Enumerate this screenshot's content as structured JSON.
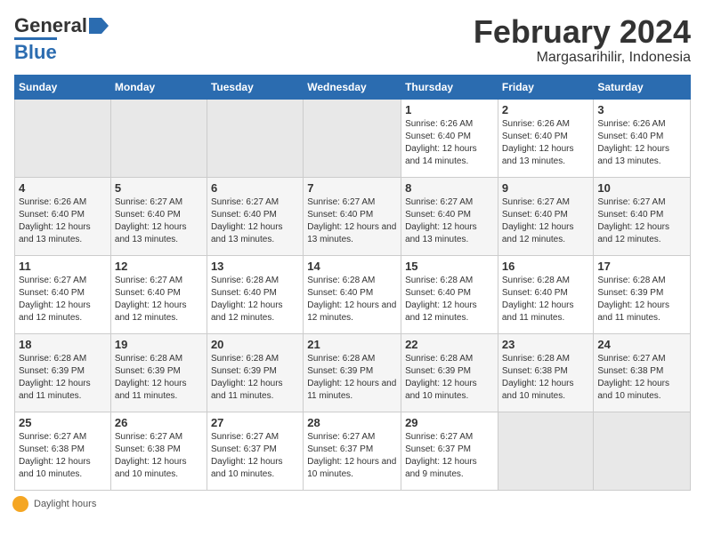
{
  "header": {
    "logo_general": "General",
    "logo_blue": "Blue",
    "month_title": "February 2024",
    "location": "Margasarihilir, Indonesia"
  },
  "days_of_week": [
    "Sunday",
    "Monday",
    "Tuesday",
    "Wednesday",
    "Thursday",
    "Friday",
    "Saturday"
  ],
  "weeks": [
    [
      {
        "num": "",
        "info": ""
      },
      {
        "num": "",
        "info": ""
      },
      {
        "num": "",
        "info": ""
      },
      {
        "num": "",
        "info": ""
      },
      {
        "num": "1",
        "info": "Sunrise: 6:26 AM\nSunset: 6:40 PM\nDaylight: 12 hours and 14 minutes."
      },
      {
        "num": "2",
        "info": "Sunrise: 6:26 AM\nSunset: 6:40 PM\nDaylight: 12 hours and 13 minutes."
      },
      {
        "num": "3",
        "info": "Sunrise: 6:26 AM\nSunset: 6:40 PM\nDaylight: 12 hours and 13 minutes."
      }
    ],
    [
      {
        "num": "4",
        "info": "Sunrise: 6:26 AM\nSunset: 6:40 PM\nDaylight: 12 hours and 13 minutes."
      },
      {
        "num": "5",
        "info": "Sunrise: 6:27 AM\nSunset: 6:40 PM\nDaylight: 12 hours and 13 minutes."
      },
      {
        "num": "6",
        "info": "Sunrise: 6:27 AM\nSunset: 6:40 PM\nDaylight: 12 hours and 13 minutes."
      },
      {
        "num": "7",
        "info": "Sunrise: 6:27 AM\nSunset: 6:40 PM\nDaylight: 12 hours and 13 minutes."
      },
      {
        "num": "8",
        "info": "Sunrise: 6:27 AM\nSunset: 6:40 PM\nDaylight: 12 hours and 13 minutes."
      },
      {
        "num": "9",
        "info": "Sunrise: 6:27 AM\nSunset: 6:40 PM\nDaylight: 12 hours and 12 minutes."
      },
      {
        "num": "10",
        "info": "Sunrise: 6:27 AM\nSunset: 6:40 PM\nDaylight: 12 hours and 12 minutes."
      }
    ],
    [
      {
        "num": "11",
        "info": "Sunrise: 6:27 AM\nSunset: 6:40 PM\nDaylight: 12 hours and 12 minutes."
      },
      {
        "num": "12",
        "info": "Sunrise: 6:27 AM\nSunset: 6:40 PM\nDaylight: 12 hours and 12 minutes."
      },
      {
        "num": "13",
        "info": "Sunrise: 6:28 AM\nSunset: 6:40 PM\nDaylight: 12 hours and 12 minutes."
      },
      {
        "num": "14",
        "info": "Sunrise: 6:28 AM\nSunset: 6:40 PM\nDaylight: 12 hours and 12 minutes."
      },
      {
        "num": "15",
        "info": "Sunrise: 6:28 AM\nSunset: 6:40 PM\nDaylight: 12 hours and 12 minutes."
      },
      {
        "num": "16",
        "info": "Sunrise: 6:28 AM\nSunset: 6:40 PM\nDaylight: 12 hours and 11 minutes."
      },
      {
        "num": "17",
        "info": "Sunrise: 6:28 AM\nSunset: 6:39 PM\nDaylight: 12 hours and 11 minutes."
      }
    ],
    [
      {
        "num": "18",
        "info": "Sunrise: 6:28 AM\nSunset: 6:39 PM\nDaylight: 12 hours and 11 minutes."
      },
      {
        "num": "19",
        "info": "Sunrise: 6:28 AM\nSunset: 6:39 PM\nDaylight: 12 hours and 11 minutes."
      },
      {
        "num": "20",
        "info": "Sunrise: 6:28 AM\nSunset: 6:39 PM\nDaylight: 12 hours and 11 minutes."
      },
      {
        "num": "21",
        "info": "Sunrise: 6:28 AM\nSunset: 6:39 PM\nDaylight: 12 hours and 11 minutes."
      },
      {
        "num": "22",
        "info": "Sunrise: 6:28 AM\nSunset: 6:39 PM\nDaylight: 12 hours and 10 minutes."
      },
      {
        "num": "23",
        "info": "Sunrise: 6:28 AM\nSunset: 6:38 PM\nDaylight: 12 hours and 10 minutes."
      },
      {
        "num": "24",
        "info": "Sunrise: 6:27 AM\nSunset: 6:38 PM\nDaylight: 12 hours and 10 minutes."
      }
    ],
    [
      {
        "num": "25",
        "info": "Sunrise: 6:27 AM\nSunset: 6:38 PM\nDaylight: 12 hours and 10 minutes."
      },
      {
        "num": "26",
        "info": "Sunrise: 6:27 AM\nSunset: 6:38 PM\nDaylight: 12 hours and 10 minutes."
      },
      {
        "num": "27",
        "info": "Sunrise: 6:27 AM\nSunset: 6:37 PM\nDaylight: 12 hours and 10 minutes."
      },
      {
        "num": "28",
        "info": "Sunrise: 6:27 AM\nSunset: 6:37 PM\nDaylight: 12 hours and 10 minutes."
      },
      {
        "num": "29",
        "info": "Sunrise: 6:27 AM\nSunset: 6:37 PM\nDaylight: 12 hours and 9 minutes."
      },
      {
        "num": "",
        "info": ""
      },
      {
        "num": "",
        "info": ""
      }
    ]
  ],
  "footer": {
    "daylight_label": "Daylight hours"
  }
}
